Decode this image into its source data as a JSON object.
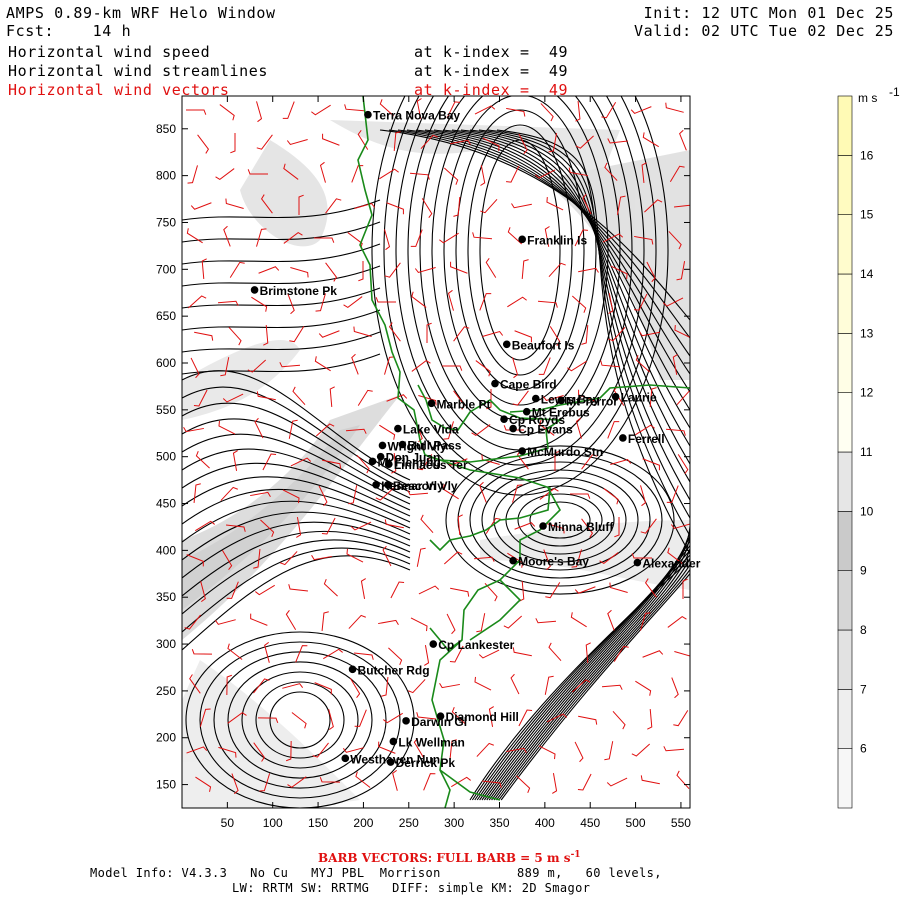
{
  "header": {
    "title": "AMPS 0.89-km WRF Helo Window",
    "forecast": "Fcst:    14 h",
    "init": "Init: 12 UTC Mon 01 Dec 25",
    "valid": "Valid: 02 UTC Tue 02 Dec 25",
    "fields": [
      {
        "name": "Horizontal wind speed",
        "level": "at k-index =  49",
        "color": "#000000"
      },
      {
        "name": "Horizontal wind streamlines",
        "level": "at k-index =  49",
        "color": "#000000"
      },
      {
        "name": "Horizontal wind vectors",
        "level": "at k-index =  49",
        "color": "#e01010"
      }
    ]
  },
  "map": {
    "x_ticks": [
      50,
      100,
      150,
      200,
      250,
      300,
      350,
      400,
      450,
      500,
      550
    ],
    "y_ticks": [
      150,
      200,
      250,
      300,
      350,
      400,
      450,
      500,
      550,
      600,
      650,
      700,
      750,
      800,
      850
    ],
    "x_range": [
      0,
      560
    ],
    "y_range": [
      125,
      885
    ],
    "coast_color": "#1a8a1a",
    "stations": [
      {
        "name": "Terra Nova Bay",
        "x": 205,
        "y": 865
      },
      {
        "name": "Franklin Is",
        "x": 375,
        "y": 732
      },
      {
        "name": "Brimstone Pk",
        "x": 80,
        "y": 678
      },
      {
        "name": "Beaufort Is",
        "x": 358,
        "y": 620
      },
      {
        "name": "Cape Bird",
        "x": 345,
        "y": 578
      },
      {
        "name": "Lewis Bay",
        "x": 390,
        "y": 562
      },
      {
        "name": "Laurie",
        "x": 478,
        "y": 564
      },
      {
        "name": "Mt Terror",
        "x": 418,
        "y": 560
      },
      {
        "name": "Marble Pt",
        "x": 275,
        "y": 557
      },
      {
        "name": "Cp Royds",
        "x": 355,
        "y": 540
      },
      {
        "name": "Mt Erebus",
        "x": 380,
        "y": 548
      },
      {
        "name": "Ferrell",
        "x": 486,
        "y": 520
      },
      {
        "name": "Lake Vida",
        "x": 238,
        "y": 530
      },
      {
        "name": "Cp Evans",
        "x": 365,
        "y": 530
      },
      {
        "name": "Wright Vly",
        "x": 221,
        "y": 512
      },
      {
        "name": "Bull Pass",
        "x": 243,
        "y": 513
      },
      {
        "name": "McMurdo Stn",
        "x": 375,
        "y": 506
      },
      {
        "name": "Don Juan",
        "x": 219,
        "y": 500
      },
      {
        "name": "Mt Fleming",
        "x": 210,
        "y": 495
      },
      {
        "name": "Linnaeus Ter",
        "x": 228,
        "y": 492
      },
      {
        "name": "Kennar Vly",
        "x": 214,
        "y": 470
      },
      {
        "name": "Beacon Vly",
        "x": 227,
        "y": 470
      },
      {
        "name": "Minna Bluff",
        "x": 398,
        "y": 426
      },
      {
        "name": "Moore's Bay",
        "x": 365,
        "y": 389
      },
      {
        "name": "Alexander",
        "x": 502,
        "y": 387
      },
      {
        "name": "Cp Lankester",
        "x": 277,
        "y": 300
      },
      {
        "name": "Butcher Rdg",
        "x": 188,
        "y": 273
      },
      {
        "name": "Darwin Gl",
        "x": 247,
        "y": 218
      },
      {
        "name": "Diamond Hill",
        "x": 285,
        "y": 223
      },
      {
        "name": "Lk Wellman",
        "x": 233,
        "y": 196
      },
      {
        "name": "Westhaven Nun",
        "x": 180,
        "y": 178
      },
      {
        "name": "Derrick Pk",
        "x": 230,
        "y": 174
      }
    ]
  },
  "colorbar": {
    "unit": "m s",
    "unit_exp": "-1",
    "labels": [
      "6",
      "7",
      "8",
      "9",
      "10",
      "11",
      "12",
      "13",
      "14",
      "15",
      "16"
    ],
    "colors": [
      "#f7f7f7",
      "#eeeeee",
      "#e2e2e2",
      "#d6d6d6",
      "#cacaca",
      "#e6e6e6",
      "#fffff2",
      "#fffee6",
      "#fffdd9",
      "#fffccd",
      "#fffbc0",
      "#fffab5"
    ]
  },
  "footer": {
    "barb_note": "BARB VECTORS:  FULL BARB = 5 m s",
    "barb_note_exp": "-1",
    "model_line1": "Model Info: V4.3.3   No Cu   MYJ PBL  Morrison          889 m,   60 levels,",
    "model_line2": "LW: RRTM SW: RRTMG   DIFF: simple KM: 2D Smagor"
  }
}
